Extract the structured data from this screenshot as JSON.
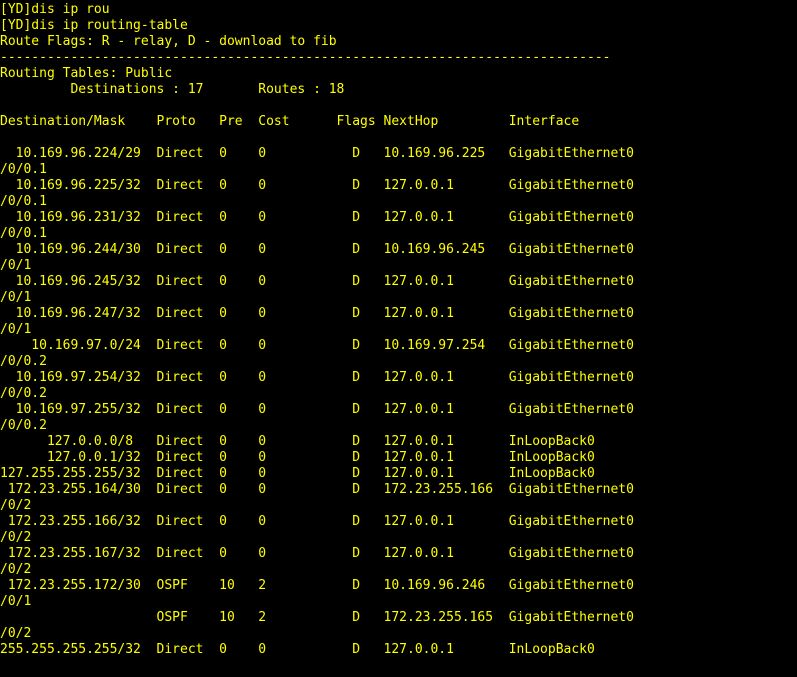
{
  "terminal": {
    "foreground_color": "#ffff00",
    "background_color": "#000000",
    "lines": [
      "[YD]dis ip rou",
      "[YD]dis ip routing-table",
      "Route Flags: R - relay, D - download to fib",
      "------------------------------------------------------------------------------",
      "Routing Tables: Public",
      "         Destinations : 17       Routes : 18",
      "",
      "Destination/Mask    Proto   Pre  Cost      Flags NextHop         Interface",
      "",
      "  10.169.96.224/29  Direct  0    0           D   10.169.96.225   GigabitEthernet0",
      "/0/0.1",
      "  10.169.96.225/32  Direct  0    0           D   127.0.0.1       GigabitEthernet0",
      "/0/0.1",
      "  10.169.96.231/32  Direct  0    0           D   127.0.0.1       GigabitEthernet0",
      "/0/0.1",
      "  10.169.96.244/30  Direct  0    0           D   10.169.96.245   GigabitEthernet0",
      "/0/1",
      "  10.169.96.245/32  Direct  0    0           D   127.0.0.1       GigabitEthernet0",
      "/0/1",
      "  10.169.96.247/32  Direct  0    0           D   127.0.0.1       GigabitEthernet0",
      "/0/1",
      "    10.169.97.0/24  Direct  0    0           D   10.169.97.254   GigabitEthernet0",
      "/0/0.2",
      "  10.169.97.254/32  Direct  0    0           D   127.0.0.1       GigabitEthernet0",
      "/0/0.2",
      "  10.169.97.255/32  Direct  0    0           D   127.0.0.1       GigabitEthernet0",
      "/0/0.2",
      "      127.0.0.0/8   Direct  0    0           D   127.0.0.1       InLoopBack0",
      "      127.0.0.1/32  Direct  0    0           D   127.0.0.1       InLoopBack0",
      "127.255.255.255/32  Direct  0    0           D   127.0.0.1       InLoopBack0",
      " 172.23.255.164/30  Direct  0    0           D   172.23.255.166  GigabitEthernet0",
      "/0/2",
      " 172.23.255.166/32  Direct  0    0           D   127.0.0.1       GigabitEthernet0",
      "/0/2",
      " 172.23.255.167/32  Direct  0    0           D   127.0.0.1       GigabitEthernet0",
      "/0/2",
      " 172.23.255.172/30  OSPF    10   2           D   10.169.96.246   GigabitEthernet0",
      "/0/1",
      "                    OSPF    10   2           D   172.23.255.165  GigabitEthernet0",
      "/0/2",
      "255.255.255.255/32  Direct  0    0           D   127.0.0.1       InLoopBack0"
    ]
  }
}
